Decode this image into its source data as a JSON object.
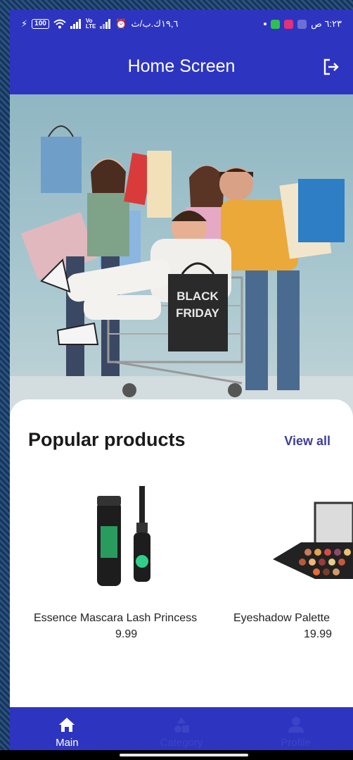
{
  "status_bar": {
    "time": "٦:٢٣ ص",
    "network_speed": "١٩,٦ك.ب/ث",
    "battery": "100",
    "volte": "Vo\nLTE"
  },
  "app_bar": {
    "title": "Home Screen",
    "logout_icon": "logout-icon"
  },
  "hero": {
    "bag_text_line1": "BLACK",
    "bag_text_line2": "FRIDAY"
  },
  "popular": {
    "title": "Popular products",
    "view_all_label": "View all",
    "products": [
      {
        "name": "Essence Mascara Lash Princess",
        "price": "9.99"
      },
      {
        "name": "Eyeshadow Palette",
        "price": "19.99"
      }
    ]
  },
  "bottom_nav": {
    "items": [
      {
        "label": "Main",
        "icon": "home-icon",
        "active": true
      },
      {
        "label": "Category",
        "icon": "category-icon",
        "active": false
      },
      {
        "label": "Profile",
        "icon": "person-icon",
        "active": false
      }
    ]
  },
  "colors": {
    "primary": "#2d35c0",
    "view_all": "#3f3e9a",
    "inactive_nav": "#3c44c6"
  }
}
